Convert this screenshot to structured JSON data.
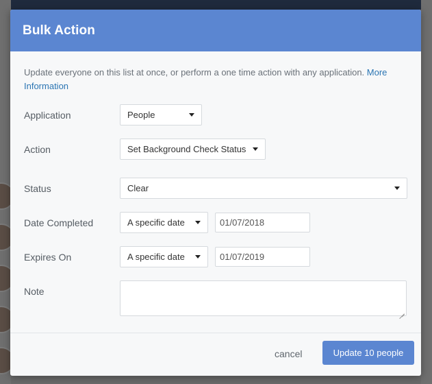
{
  "modal": {
    "title": "Bulk Action",
    "intro_text": "Update everyone on this list at once, or perform a one time action with any application.",
    "intro_link": "More Information"
  },
  "form": {
    "application": {
      "label": "Application",
      "value": "People"
    },
    "action": {
      "label": "Action",
      "value": "Set Background Check Status"
    },
    "status": {
      "label": "Status",
      "value": "Clear"
    },
    "date_completed": {
      "label": "Date Completed",
      "mode": "A specific date",
      "date": "01/07/2018"
    },
    "expires_on": {
      "label": "Expires On",
      "mode": "A specific date",
      "date": "01/07/2019"
    },
    "note": {
      "label": "Note",
      "value": ""
    }
  },
  "footer": {
    "cancel_label": "cancel",
    "submit_label": "Update 10 people"
  },
  "colors": {
    "header_bg": "#5b86d1",
    "primary_button": "#5b86d1",
    "link": "#2b75b3"
  }
}
